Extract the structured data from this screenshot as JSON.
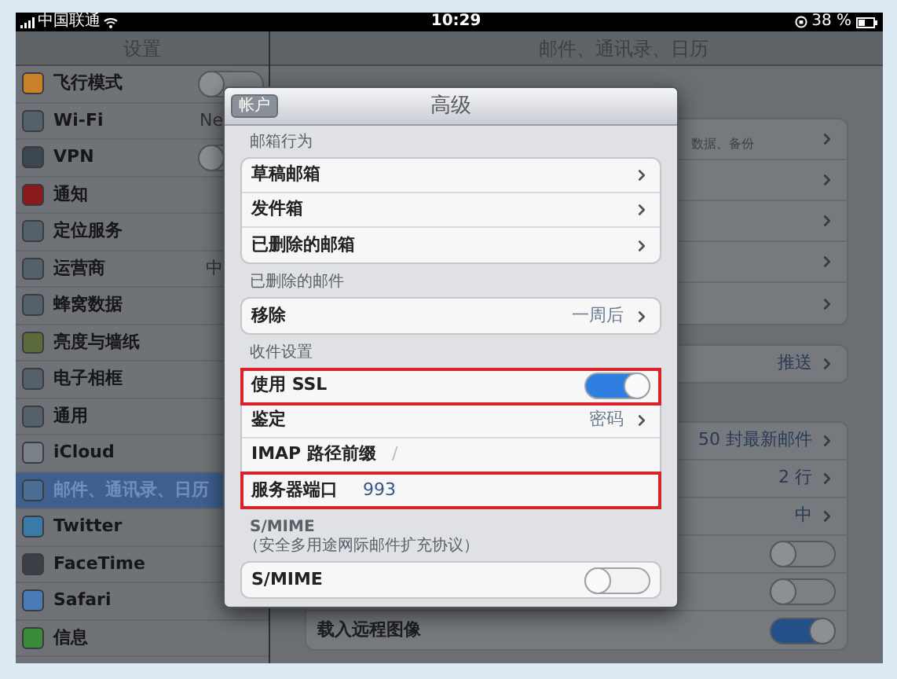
{
  "status_bar": {
    "carrier": "中国联通",
    "time": "10:29",
    "battery": "38 %"
  },
  "sidebar": {
    "title": "设置",
    "items": [
      {
        "label": "飞行模式",
        "kind": "toggle",
        "on": false,
        "selected": false
      },
      {
        "label": "Wi-Fi",
        "kind": "value",
        "value": "Ne",
        "selected": false
      },
      {
        "label": "VPN",
        "kind": "toggle",
        "on": false,
        "selected": false
      },
      {
        "label": "通知",
        "kind": "plain",
        "selected": false
      },
      {
        "label": "定位服务",
        "kind": "plain",
        "selected": false
      },
      {
        "label": "运营商",
        "kind": "value",
        "value": "中",
        "selected": false
      },
      {
        "label": "蜂窝数据",
        "kind": "plain",
        "selected": false
      },
      {
        "label": "亮度与墙纸",
        "kind": "plain",
        "selected": false
      },
      {
        "label": "电子相框",
        "kind": "plain",
        "selected": false
      },
      {
        "label": "通用",
        "kind": "plain",
        "selected": false
      },
      {
        "label": "iCloud",
        "kind": "plain",
        "selected": false
      },
      {
        "label": "邮件、通讯录、日历",
        "kind": "plain",
        "selected": true
      },
      {
        "label": "Twitter",
        "kind": "plain",
        "selected": false
      },
      {
        "label": "FaceTime",
        "kind": "plain",
        "selected": false
      },
      {
        "label": "Safari",
        "kind": "plain",
        "selected": false
      },
      {
        "label": "信息",
        "kind": "plain",
        "selected": false
      }
    ]
  },
  "detail": {
    "title": "邮件、通讯录、日历",
    "groups": [
      {
        "rows": [
          {
            "kind": "link",
            "detail": "数据、备份"
          },
          {
            "kind": "link"
          },
          {
            "kind": "link"
          },
          {
            "kind": "link"
          },
          {
            "kind": "link"
          }
        ]
      },
      {
        "rows": [
          {
            "kind": "link",
            "value": "推送"
          }
        ]
      },
      {
        "rows": [
          {
            "kind": "link",
            "value": "50 封最新邮件"
          },
          {
            "kind": "link",
            "value": "2 行"
          },
          {
            "kind": "link",
            "value": "中"
          },
          {
            "kind": "toggle",
            "on": false
          },
          {
            "kind": "toggle",
            "on": false
          },
          {
            "kind": "toggle",
            "on": true,
            "label": "载入远程图像"
          }
        ]
      }
    ]
  },
  "modal": {
    "back": "帐户",
    "title": "高级",
    "sections": [
      {
        "header": "邮箱行为",
        "rows": [
          {
            "kind": "link",
            "label": "草稿邮箱",
            "highlighted": false
          },
          {
            "kind": "link",
            "label": "发件箱",
            "highlighted": false
          },
          {
            "kind": "link",
            "label": "已删除的邮箱",
            "highlighted": false
          }
        ]
      },
      {
        "header": "已删除的邮件",
        "rows": [
          {
            "kind": "link",
            "label": "移除",
            "value": "一周后",
            "highlighted": false
          }
        ]
      },
      {
        "header": "收件设置",
        "rows": [
          {
            "kind": "toggle",
            "label": "使用 SSL",
            "on": true,
            "highlighted": true
          },
          {
            "kind": "link",
            "label": "鉴定",
            "value": "密码",
            "highlighted": false
          },
          {
            "kind": "text",
            "label": "IMAP 路径前缀",
            "placeholder": "/",
            "highlighted": false
          },
          {
            "kind": "text",
            "label": "服务器端口",
            "value": "993",
            "highlighted": true
          }
        ]
      },
      {
        "header": "S/MIME",
        "subheader": "（安全多用途网际邮件扩充协议）",
        "rows": [
          {
            "kind": "toggle",
            "label": "S/MIME",
            "on": false,
            "highlighted": false
          }
        ]
      }
    ]
  }
}
